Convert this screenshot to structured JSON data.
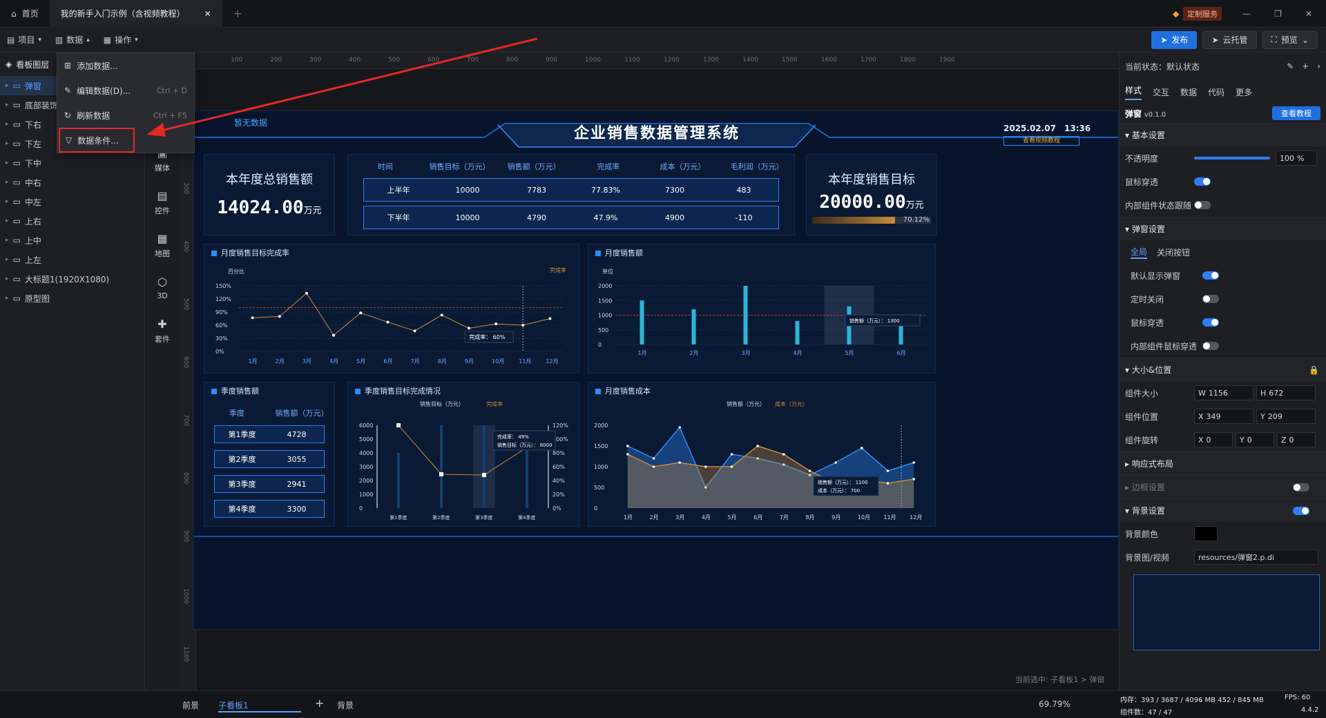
{
  "titlebar": {
    "home": "首页",
    "tab_title": "我的新手入门示例（含视频教程）",
    "custom_service": "定制服务"
  },
  "menubar": {
    "project": "项目",
    "data": "数据",
    "operate": "操作",
    "publish": "发布",
    "cloud": "云托管",
    "preview": "预览"
  },
  "dropdown": [
    {
      "label": "添加数据...",
      "shortcut": ""
    },
    {
      "label": "编辑数据(D)...",
      "shortcut": "Ctrl + D"
    },
    {
      "label": "刷新数据",
      "shortcut": "Ctrl + F5"
    },
    {
      "label": "数据条件...",
      "shortcut": ""
    }
  ],
  "left": {
    "header": "看板图层",
    "layers": [
      "弹窗",
      "底部装饰",
      "下右",
      "下左",
      "下中",
      "中右",
      "中左",
      "上右",
      "上中",
      "上左",
      "大标题1(1920X1080)",
      "原型图"
    ],
    "tools": [
      "媒体",
      "控件",
      "地图",
      "3D",
      "套件"
    ]
  },
  "ruler": {
    "h": [
      "100",
      "200",
      "300",
      "400",
      "500",
      "600",
      "700",
      "800",
      "900",
      "1000",
      "1100",
      "1200",
      "1300",
      "1400",
      "1500",
      "1600",
      "1700",
      "1800",
      "1900"
    ],
    "v": [
      "200",
      "300",
      "400",
      "500",
      "600",
      "700",
      "800",
      "900",
      "1000",
      "1100"
    ]
  },
  "screen": {
    "no_data": "暂无数据",
    "title": "企业销售数据管理系统",
    "date": "2025.02.07",
    "time": "13:36",
    "video_btn": "查看视频教程",
    "total_sales_label": "本年度总销售额",
    "total_sales_value": "14024.00",
    "unit": "万元",
    "target_label": "本年度销售目标",
    "target_value": "20000.00",
    "target_pct": "70.12%",
    "table": {
      "headers": [
        "时间",
        "销售目标（万元）",
        "销售额（万元）",
        "完成率",
        "成本（万元）",
        "毛利润（万元）"
      ],
      "rows": [
        [
          "上半年",
          "10000",
          "7783",
          "77.83%",
          "7300",
          "483"
        ],
        [
          "下半年",
          "10000",
          "4790",
          "47.9%",
          "4900",
          "-110"
        ]
      ]
    },
    "quarter": {
      "title": "季度销售额",
      "headers": [
        "季度",
        "销售额（万元）"
      ],
      "rows": [
        [
          "第1季度",
          "4728"
        ],
        [
          "第2季度",
          "3055"
        ],
        [
          "第3季度",
          "2941"
        ],
        [
          "第4季度",
          "3300"
        ]
      ]
    }
  },
  "chart_data": [
    {
      "type": "line",
      "title": "月度销售目标完成率",
      "ylabel": "百分比",
      "legend": "完成率",
      "categories": [
        "1月",
        "2月",
        "3月",
        "4月",
        "5月",
        "6月",
        "7月",
        "8月",
        "9月",
        "10月",
        "11月",
        "12月"
      ],
      "values": [
        77,
        80,
        133,
        37,
        88,
        67,
        47,
        83,
        53,
        63,
        60,
        75
      ],
      "yticks": [
        "0%",
        "30%",
        "60%",
        "90%",
        "120%",
        "150%"
      ],
      "ylim": [
        0,
        150
      ],
      "tooltip": "完成率： 60%"
    },
    {
      "type": "bar",
      "title": "月度销售额",
      "ylabel": "单位",
      "categories": [
        "1月",
        "2月",
        "3月",
        "4月",
        "5月",
        "6月"
      ],
      "values": [
        1500,
        1200,
        2000,
        800,
        1300,
        700
      ],
      "yticks": [
        "0",
        "500",
        "1000",
        "1500",
        "2000"
      ],
      "ylim": [
        0,
        2000
      ],
      "tooltip": "销售额（万元）： 1300"
    },
    {
      "type": "bar",
      "title": "季度销售目标完成情况",
      "legend": [
        "销售目标（万元）",
        "完成率"
      ],
      "categories": [
        "第1季度",
        "第2季度",
        "第3季度",
        "第4季度"
      ],
      "values": [
        4000,
        6000,
        6000,
        4500
      ],
      "rate": [
        120,
        49,
        48,
        88
      ],
      "yticks": [
        "0",
        "1000",
        "2000",
        "3000",
        "4000",
        "5000",
        "6000"
      ],
      "y2ticks": [
        "0%",
        "20%",
        "40%",
        "60%",
        "80%",
        "100%",
        "120%"
      ],
      "tooltip": [
        "完成率： 49%",
        "销售目标（万元）： 6000"
      ]
    },
    {
      "type": "area",
      "title": "月度销售成本",
      "legend": [
        "销售额（万元）",
        "成本（万元）"
      ],
      "categories": [
        "1月",
        "2月",
        "3月",
        "4月",
        "5月",
        "6月",
        "7月",
        "8月",
        "9月",
        "10月",
        "11月",
        "12月"
      ],
      "series": [
        {
          "name": "销售额（万元）",
          "values": [
            1500,
            1200,
            1950,
            500,
            1300,
            1200,
            1050,
            800,
            1100,
            1450,
            900,
            1100
          ]
        },
        {
          "name": "成本（万元）",
          "values": [
            1300,
            1000,
            1100,
            1000,
            1000,
            1500,
            1300,
            900,
            600,
            700,
            600,
            700
          ]
        }
      ],
      "yticks": [
        "0",
        "500",
        "1000",
        "1500",
        "2000"
      ],
      "ylim": [
        0,
        2000
      ],
      "tooltip": [
        "销售额（万元）： 1100",
        "成本（万元）： 700"
      ]
    }
  ],
  "right": {
    "state": "当前状态：默认状态",
    "tabs": [
      "样式",
      "交互",
      "数据",
      "代码",
      "更多"
    ],
    "component": "弹窗",
    "version": "v0.1.0",
    "tutorial": "查看教程",
    "basic": "基本设置",
    "opacity": "不透明度",
    "opacity_val": "100",
    "opacity_unit": "%",
    "mouse_through": "鼠标穿透",
    "inner_state": "内部组件状态跟随",
    "popup": "弹窗设置",
    "popup_tabs": [
      "全局",
      "关闭按钮"
    ],
    "default_show": "默认显示弹窗",
    "timed_close": "定时关闭",
    "mouse_through2": "鼠标穿透",
    "inner_mouse": "内部组件鼠标穿透",
    "size_pos": "大小&位置",
    "comp_size": "组件大小",
    "w": "1156",
    "h": "672",
    "comp_pos": "组件位置",
    "x": "349",
    "y": "209",
    "rotate": "组件旋转",
    "rx": "0",
    "ry": "0",
    "rz": "0",
    "px": "px",
    "deg": "°",
    "responsive": "响应式布局",
    "border": "边框设置",
    "bg": "背景设置",
    "bg_color": "背景颜色",
    "bg_image": "背景图/视频",
    "bg_file": "resources/弹窗2.p.di"
  },
  "status": {
    "front": "前景",
    "child": "子看板1",
    "back": "背景",
    "zoom": "69.79%",
    "selected": "当前选中: 子看板1 > 弹窗",
    "mem": "内存：393 / 3687 / 4096 MB  452 / 845 MB",
    "fps": "FPS: 60",
    "count": "组件数：47 / 47",
    "ver": "4.4.2"
  }
}
